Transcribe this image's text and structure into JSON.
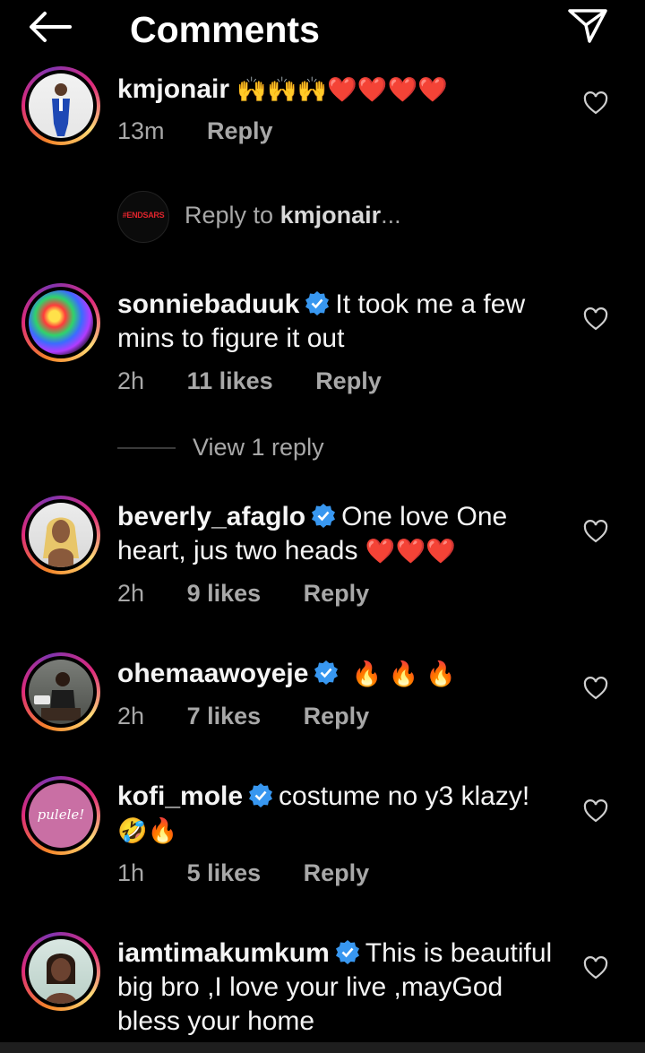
{
  "header": {
    "title": "Comments"
  },
  "comments": [
    {
      "username": "kmjonair",
      "text": "",
      "emoji_inline": "🙌🙌🙌❤️❤️❤️❤️",
      "time": "13m",
      "likes": "",
      "reply": "Reply",
      "verified": false
    },
    {
      "username": "sonniebaduuk",
      "text": "It took me a few mins to figure it out",
      "emoji_inline": "",
      "time": "2h",
      "likes": "11 likes",
      "reply": "Reply",
      "verified": true
    },
    {
      "username": "beverly_afaglo",
      "text": "One love One heart, jus two heads",
      "emoji_inline": "❤️❤️❤️",
      "time": "2h",
      "likes": "9 likes",
      "reply": "Reply",
      "verified": true
    },
    {
      "username": "ohemaawoyeje",
      "text": "",
      "emoji_inline": "🔥 🔥 🔥",
      "time": "2h",
      "likes": "7 likes",
      "reply": "Reply",
      "verified": true
    },
    {
      "username": "kofi_mole",
      "text": "costume no y3 klazy!",
      "emoji_inline": "🤣🔥",
      "time": "1h",
      "likes": "5 likes",
      "reply": "Reply",
      "verified": true
    },
    {
      "username": "iamtimakumkum",
      "text": "This is beautiful big bro ,I love your live ,mayGod bless your home",
      "emoji_inline": "",
      "time": "",
      "likes": "",
      "reply": "",
      "verified": true
    }
  ],
  "reply_input": {
    "avatar_tag": "#ENDSARS",
    "prefix": "Reply to ",
    "target": "kmjonair",
    "suffix": "..."
  },
  "view_replies": "View 1 reply",
  "avatar_labels": {
    "kofi_mole": "pulele!"
  },
  "colors": {
    "background": "#000000",
    "secondary_text": "#a8a8a8",
    "verified_blue": "#3897f0"
  }
}
